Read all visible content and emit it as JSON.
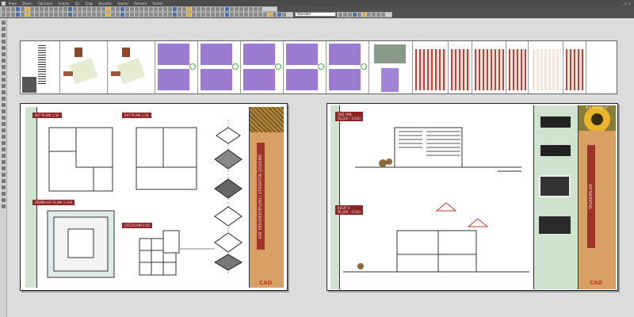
{
  "menu": [
    "Proje",
    "Düzen",
    "Görünüm",
    "Araçlar",
    "Çiz",
    "Çizgi",
    "Boyutlar",
    "Ayarlar",
    "Pencere",
    "Yardım"
  ],
  "toolbar": {
    "style_dropdown": "Standart"
  },
  "window_controls": "_ □ ×",
  "left_sheet": {
    "labels": [
      "KAT PLANI 1:50",
      "KAT PLANI 1:50",
      "ZEMİN KAT PLANI 1:100",
      "ÇATI PLANI 1:50"
    ],
    "title_vertical": "KAT PERSPEKTİFLERİ / STRÜKTÜR ÇÖZÜMÜ",
    "logo": "CAD"
  },
  "right_sheet": {
    "label_side": "SAĞ YAN\nÖLÇEK : 1/100",
    "label_side_l1": "SAĞ YAN",
    "label_side_l2": "ÖLÇEK : 1/100",
    "label_section_l1": "KESİT A",
    "label_section_l2": "ÖLÇEK : 1/100",
    "title_vertical": "TASARIMLAR",
    "header_text": "ecologic",
    "logo": "CAD"
  },
  "colors": {
    "accent_red": "#8e2424",
    "green_band": "#cfe3cf",
    "orange_title": "#d9a064",
    "plan_purple": "#7b4fc4"
  }
}
